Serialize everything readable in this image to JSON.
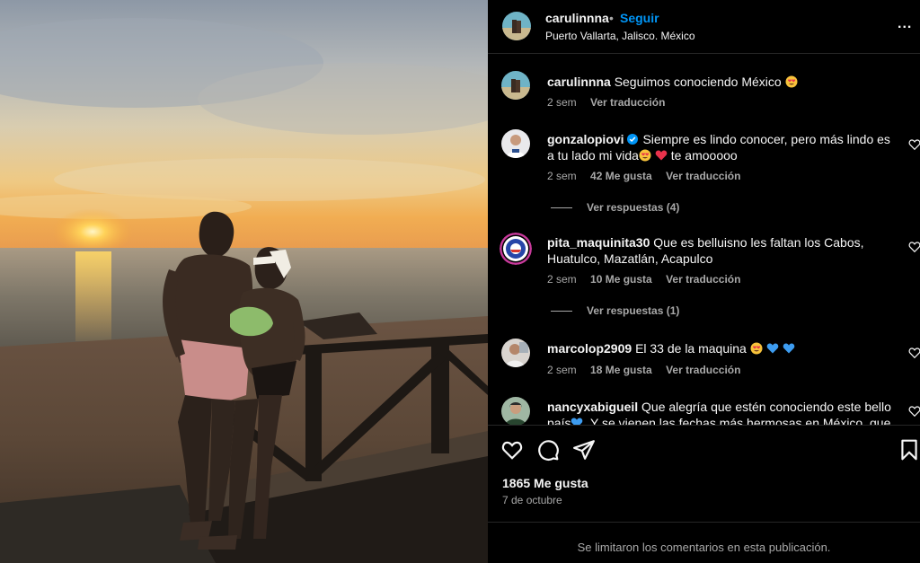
{
  "post": {
    "author": "carulinnna",
    "follow_label": "Seguir",
    "separator": "•",
    "location": "Puerto Vallarta, Jalisco. México",
    "more_label": "...",
    "caption_text": "Seguimos conociendo México",
    "caption_time": "2 sem",
    "translate_label": "Ver traducción",
    "likes": "1865 Me gusta",
    "date": "7 de octubre",
    "comments_limited": "Se limitaron los comentarios en esta publicación."
  },
  "comments": [
    {
      "user": "gonzalopiovi",
      "text_a": "Siempre es lindo conocer, pero más lindo es a tu lado mi vida",
      "text_b": "te amooooo",
      "time": "2 sem",
      "likes": "42 Me gusta",
      "translate": "Ver traducción",
      "replies": "Ver respuestas (4)"
    },
    {
      "user": "pita_maquinita30",
      "text": "Que es belluisno les faltan los Cabos, Huatulco, Mazatlán, Acapulco",
      "time": "2 sem",
      "likes": "10 Me gusta",
      "translate": "Ver traducción",
      "replies": "Ver respuestas (1)"
    },
    {
      "user": "marcolop2909",
      "text": "El 33 de la maquina",
      "time": "2 sem",
      "likes": "18 Me gusta",
      "translate": "Ver traducción"
    },
    {
      "user": "nancyxabigueil",
      "text_a": "Que alegría que estén conociendo este bello país",
      "text_b": ". Y se vienen las fechas más hermosas en México, que es"
    }
  ],
  "icons": {
    "like": "heart-icon",
    "comment": "comment-icon",
    "share": "paper-plane-icon",
    "save": "bookmark-icon",
    "more": "more-options-icon"
  },
  "colors": {
    "background": "#000000",
    "link": "#0095f6",
    "secondary_text": "#a8a8a8",
    "heart_red": "#ed4956",
    "blue_heart": "#3d9cf0"
  }
}
